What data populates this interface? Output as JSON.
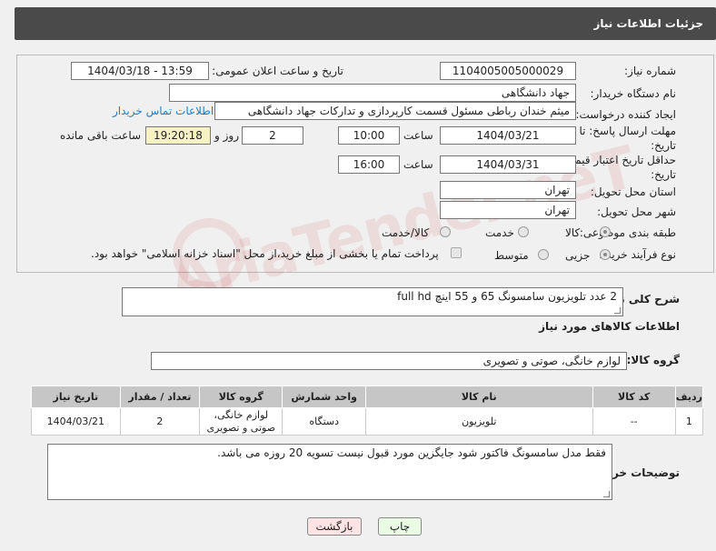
{
  "header": {
    "title": "جزئیات اطلاعات نیاز"
  },
  "form": {
    "need_number_label": "شماره نیاز:",
    "need_number": "1104005005000029",
    "announce_label": "تاریخ و ساعت اعلان عمومی:",
    "announce_value": "1404/03/18 - 13:59",
    "buyer_org_label": "نام دستگاه خریدار:",
    "buyer_org": "جهاد دانشگاهی",
    "creator_label": "ایجاد کننده درخواست:",
    "creator": "میثم خندان رباطی مسئول قسمت کارپردازی و تدارکات جهاد دانشگاهی",
    "contact_link": "اطلاعات تماس خریدار",
    "deadline_label": "مهلت ارسال پاسخ: تا تاریخ:",
    "deadline_date": "1404/03/21",
    "hour_label": "ساعت",
    "deadline_time": "10:00",
    "days_value": "2",
    "days_label": "روز و",
    "remaining_time": "19:20:18",
    "remaining_label": "ساعت باقی مانده",
    "price_valid_label": "حداقل تاریخ اعتبار قیمت: تا تاریخ:",
    "price_valid_date": "1404/03/31",
    "price_valid_time": "16:00",
    "province_label": "استان محل تحویل:",
    "province": "تهران",
    "city_label": "شهر محل تحویل:",
    "city": "تهران",
    "category_label": "طبقه بندی موضوعی:",
    "category_options": [
      "کالا",
      "خدمت",
      "کالا/خدمت"
    ],
    "process_label": "نوع فرآیند خرید :",
    "process_options": [
      "جزیی",
      "متوسط"
    ],
    "payment_note": "پرداخت تمام یا بخشی از مبلغ خرید،از محل \"اسناد خزانه اسلامی\" خواهد بود."
  },
  "description": {
    "label": "شرح کلی نیاز:",
    "text": "2 عدد تلویزیون سامسونگ 65 و 55 اینچ full hd"
  },
  "goods": {
    "section_title": "اطلاعات کالاهای مورد نیاز",
    "group_label": "گروه کالا:",
    "group_value": "لوازم خانگی، صوتی و تصویری",
    "headers": [
      "ردیف",
      "کد کالا",
      "نام کالا",
      "واحد شمارش",
      "گروه کالا",
      "تعداد / مقدار",
      "تاریخ نیاز"
    ],
    "rows": [
      [
        "1",
        "--",
        "تلویزیون",
        "دستگاه",
        "لوازم خانگی، صوتی و تصویری",
        "2",
        "1404/03/21"
      ]
    ]
  },
  "buyer_notes": {
    "label": "توضیحات خریدار:",
    "text": "فقط مدل سامسونگ فاکتور شود جایگزین مورد قبول نیست تسویه 20 روزه می باشد."
  },
  "buttons": {
    "print": "چاپ",
    "back": "بازگشت"
  },
  "watermark": "AriaTender.neT"
}
